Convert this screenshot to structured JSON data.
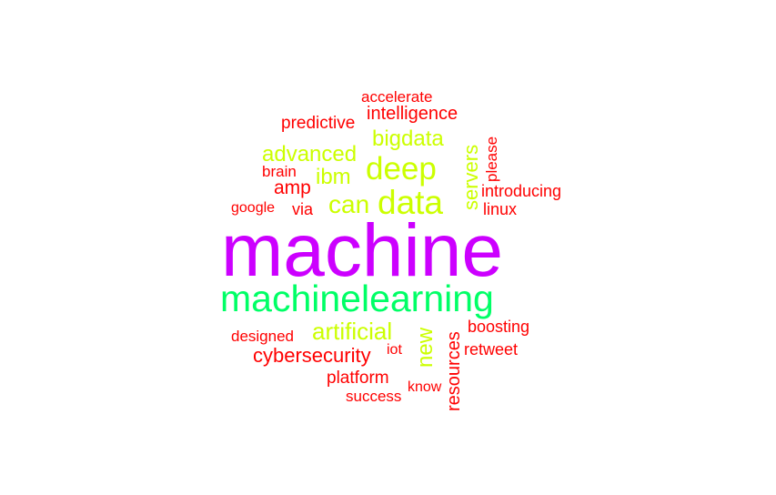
{
  "colors": {
    "top": "#cc00ff",
    "second": "#00ff66",
    "mid": "#ccff00",
    "low": "#ff0000"
  },
  "words": {
    "machine": "machine",
    "machinelearning": "machinelearning",
    "data": "data",
    "deep": "deep",
    "can": "can",
    "bigdata": "bigdata",
    "advanced": "advanced",
    "ibm": "ibm",
    "servers": "servers",
    "artificial": "artificial",
    "new": "new",
    "intelligence": "intelligence",
    "accelerate": "accelerate",
    "predictive": "predictive",
    "please": "please",
    "brain": "brain",
    "amp": "amp",
    "introducing": "introducing",
    "google": "google",
    "via": "via",
    "linux": "linux",
    "boosting": "boosting",
    "designed": "designed",
    "retweet": "retweet",
    "cybersecurity": "cybersecurity",
    "iot": "iot",
    "resources": "resources",
    "platform": "platform",
    "know": "know",
    "success": "success"
  }
}
